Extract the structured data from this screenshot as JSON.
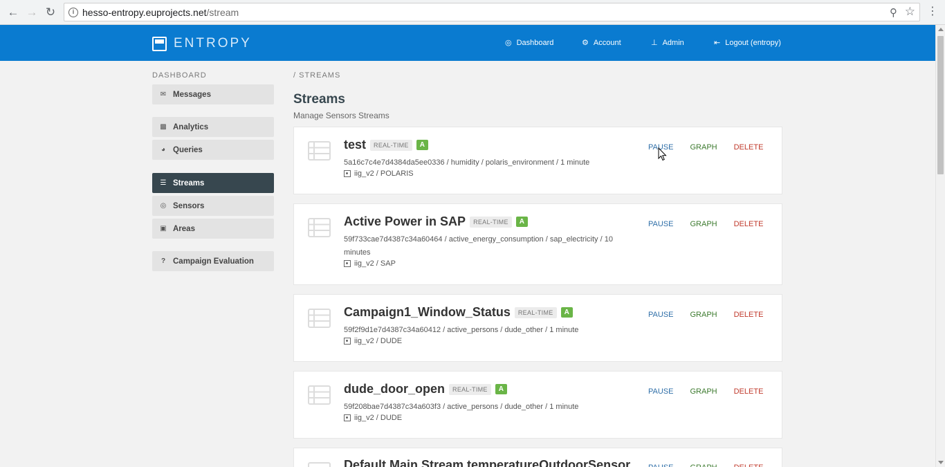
{
  "browser": {
    "url_host": "hesso-entropy.euprojects.net",
    "url_path": "/stream",
    "back_icon": "arrow-left-icon",
    "forward_icon": "arrow-right-icon",
    "reload_icon": "reload-icon"
  },
  "header": {
    "brand": "ENTROPY",
    "nav": [
      {
        "label": "Dashboard",
        "icon": "dashboard-icon"
      },
      {
        "label": "Account",
        "icon": "gear-icon"
      },
      {
        "label": "Admin",
        "icon": "pin-icon"
      },
      {
        "label": "Logout (entropy)",
        "icon": "logout-icon"
      }
    ]
  },
  "sidebar": {
    "heading": "DASHBOARD",
    "items": [
      {
        "label": "Messages",
        "icon": "inbox-icon"
      },
      {
        "label": "Analytics",
        "icon": "bar-chart-icon"
      },
      {
        "label": "Queries",
        "icon": "pie-chart-icon"
      },
      {
        "label": "Streams",
        "icon": "list-icon",
        "active": true
      },
      {
        "label": "Sensors",
        "icon": "target-icon"
      },
      {
        "label": "Areas",
        "icon": "map-icon"
      },
      {
        "label": "Campaign Evaluation",
        "icon": "question-icon"
      }
    ]
  },
  "main": {
    "breadcrumb": "/ STREAMS",
    "title": "Streams",
    "subtitle": "Manage Sensors Streams",
    "streams": [
      {
        "name": "test",
        "badge_type": "REAL-TIME",
        "badge_status": "A",
        "meta": "5a16c7c4e7d4384da5ee0336 / humidity / polaris_environment / 1 minute",
        "location": "iig_v2 / POLARIS"
      },
      {
        "name": "Active Power in SAP",
        "badge_type": "REAL-TIME",
        "badge_status": "A",
        "meta": "59f733cae7d4387c34a60464 / active_energy_consumption / sap_electricity / 10 minutes",
        "location": "iig_v2 / SAP"
      },
      {
        "name": "Campaign1_Window_Status",
        "badge_type": "REAL-TIME",
        "badge_status": "A",
        "meta": "59f2f9d1e7d4387c34a60412 / active_persons / dude_other / 1 minute",
        "location": "iig_v2 / DUDE"
      },
      {
        "name": "dude_door_open",
        "badge_type": "REAL-TIME",
        "badge_status": "A",
        "meta": "59f208bae7d4387c34a603f3 / active_persons / dude_other / 1 minute",
        "location": "iig_v2 / DUDE"
      },
      {
        "name": "Default Main Stream temperatureOutdoorSensor",
        "badge_type": "",
        "badge_status": "",
        "meta": "",
        "location": ""
      }
    ],
    "actions": {
      "pause": "PAUSE",
      "graph": "GRAPH",
      "delete": "DELETE"
    }
  },
  "colors": {
    "header_bg": "#0a7bd0",
    "sidebar_active": "#37474f",
    "pause": "#2f6fa8",
    "graph": "#3c7a2e",
    "delete": "#c0392b",
    "badge_a": "#6ab547"
  }
}
